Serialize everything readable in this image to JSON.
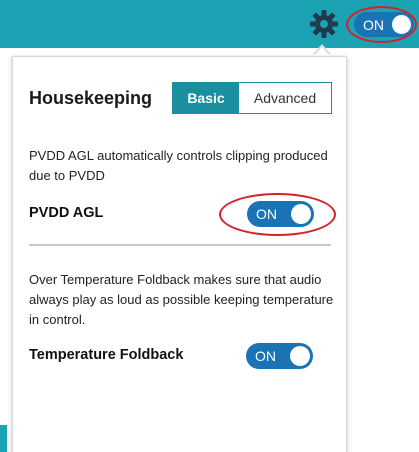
{
  "topbar": {
    "toggle_label": "ON",
    "accent_color": "#1ba3b4",
    "settings_icon": "gear-icon"
  },
  "panel": {
    "title": "Housekeeping",
    "tabs": [
      {
        "label": "Basic",
        "selected": true
      },
      {
        "label": "Advanced",
        "selected": false
      }
    ],
    "pvdd": {
      "description": "PVDD AGL automatically controls clipping produced due to PVDD",
      "label": "PVDD AGL",
      "toggle_label": "ON"
    },
    "temperature": {
      "description": "Over Temperature Foldback makes sure that audio always play as loud as possible keeping temperature in control.",
      "label": "Temperature Foldback",
      "toggle_label": "ON"
    }
  },
  "colors": {
    "toggle_on": "#1a73b5",
    "tab_selected": "#1a8fa0",
    "highlight_ring": "#d2232a"
  }
}
